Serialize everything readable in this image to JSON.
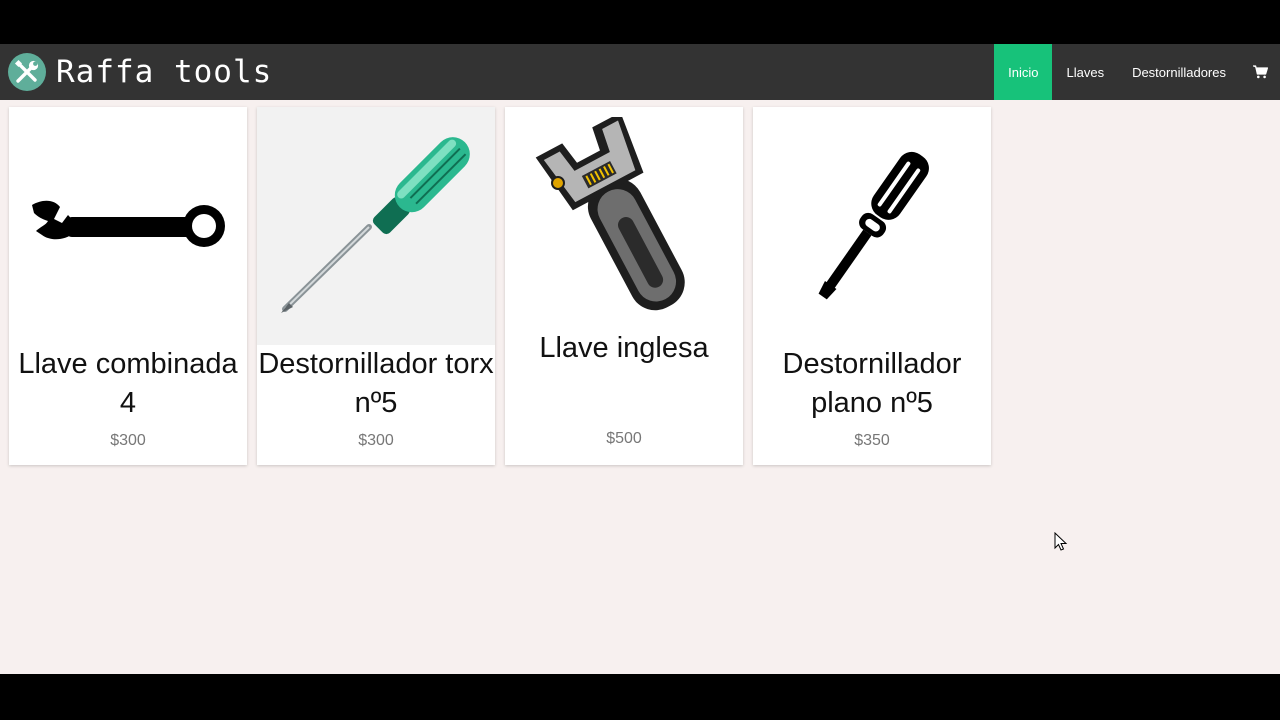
{
  "brand": {
    "name": "Raffa tools",
    "logo_icon": "wrench-screwdriver-icon"
  },
  "nav": {
    "items": [
      {
        "label": "Inicio",
        "active": true
      },
      {
        "label": "Llaves",
        "active": false
      },
      {
        "label": "Destornilladores",
        "active": false
      }
    ],
    "cart_icon": "shopping-cart-icon"
  },
  "products": [
    {
      "name": "Llave combinada 4",
      "price": "$300",
      "icon": "combination-wrench-icon"
    },
    {
      "name": "Destornillador torx nº5",
      "price": "$300",
      "icon": "torx-screwdriver-icon"
    },
    {
      "name": "Llave inglesa",
      "price": "$500",
      "icon": "adjustable-wrench-icon"
    },
    {
      "name": "Destornillador plano nº5",
      "price": "$350",
      "icon": "flat-screwdriver-icon"
    }
  ],
  "colors": {
    "navbar": "#333333",
    "active_tab": "#17c27a",
    "page_bg": "#f7f0ef"
  }
}
